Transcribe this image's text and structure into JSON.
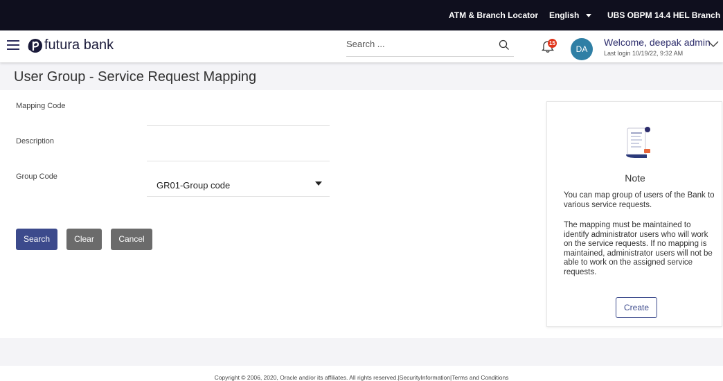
{
  "topbar": {
    "locator": "ATM & Branch Locator",
    "language": "English",
    "branch": "UBS OBPM 14.4 HEL Branch"
  },
  "header": {
    "brand": "futura bank",
    "search_placeholder": "Search ...",
    "notification_count": "15",
    "avatar_initials": "DA",
    "welcome": "Welcome, deepak admin",
    "last_login": "Last login 10/19/22, 9:32 AM"
  },
  "page": {
    "title": "User Group - Service Request Mapping"
  },
  "form": {
    "mapping_code_label": "Mapping Code",
    "description_label": "Description",
    "group_code_label": "Group Code",
    "group_code_value": "GR01-Group code"
  },
  "buttons": {
    "search": "Search",
    "clear": "Clear",
    "cancel": "Cancel"
  },
  "note": {
    "title": "Note",
    "paragraph1": "You can map group of users of the Bank to various service requests.",
    "paragraph2": "The mapping must be maintained to identify administrator users who will work on the service requests. If no mapping is maintained, administrator users will not be able to work on the assigned service requests.",
    "create_label": "Create"
  },
  "footer": {
    "copyright": "Copyright © 2006, 2020, Oracle and/or its affiliates. All rights reserved.|SecurityInformation|Terms and Conditions"
  },
  "colors": {
    "topbar_bg": "#0f0f1e",
    "primary_button": "#3c4a8c",
    "secondary_button": "#6b6b6b",
    "badge": "#e0341a",
    "avatar": "#2f7fa5"
  }
}
